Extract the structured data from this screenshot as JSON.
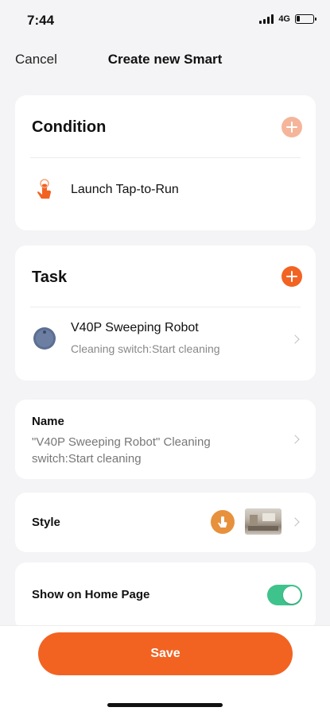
{
  "status_bar": {
    "time": "7:44",
    "network": "4G"
  },
  "nav": {
    "cancel_label": "Cancel",
    "title": "Create new Smart"
  },
  "condition": {
    "header": "Condition",
    "items": [
      {
        "icon": "tap-hand-icon",
        "label": "Launch Tap-to-Run"
      }
    ]
  },
  "task": {
    "header": "Task",
    "items": [
      {
        "icon": "robot-vacuum-icon",
        "title": "V40P Sweeping Robot",
        "subtitle": "Cleaning switch:Start cleaning"
      }
    ]
  },
  "name": {
    "label": "Name",
    "value_line1": "\"V40P Sweeping Robot\" Cleaning",
    "value_line2": "switch:Start cleaning"
  },
  "style": {
    "label": "Style",
    "icon": "tap-hand-icon",
    "thumbnail": "room-thumbnail"
  },
  "show_home": {
    "label": "Show on Home Page",
    "enabled": true
  },
  "save": {
    "label": "Save"
  },
  "colors": {
    "accent": "#f26322",
    "accent_light": "#f5b59a",
    "toggle_on": "#3fc38c",
    "style_icon": "#e7913d"
  }
}
